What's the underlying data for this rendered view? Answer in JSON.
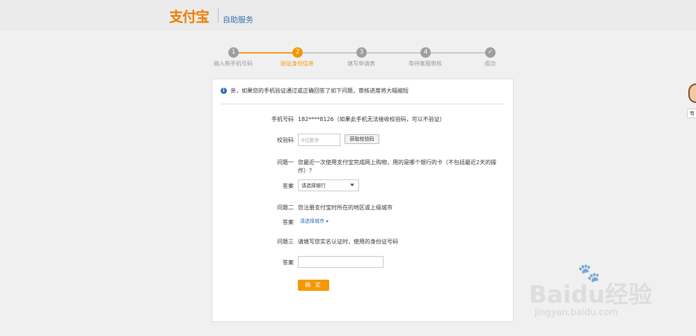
{
  "header": {
    "logo_text": "支付宝",
    "service_title": "自助服务"
  },
  "steps": [
    {
      "num": "1",
      "label": "输入新手机号码",
      "state": "done"
    },
    {
      "num": "2",
      "label": "验证身份信息",
      "state": "active"
    },
    {
      "num": "3",
      "label": "填写申请表",
      "state": "todo"
    },
    {
      "num": "4",
      "label": "等待客服审核",
      "state": "todo"
    },
    {
      "num": "✓",
      "label": "成功",
      "state": "todo"
    }
  ],
  "notice": {
    "icon": "info-icon",
    "text": "亲，如果您的手机验证通过或正确回答了如下问题，审核进度将大幅缩短"
  },
  "form": {
    "phone_label": "手机号码",
    "phone_value": "182****8126（如果此手机无法接收校验码，可以不验证）",
    "code_label": "校验码",
    "code_placeholder": "6位数字",
    "get_code_button": "获取校验码",
    "q1_label": "问题一",
    "q1_text_line1": "您最近一次使用支付宝完成网上购物，用的是哪个银行的卡（不包括最近2天的操",
    "q1_text_line2": "作）？",
    "answer_label": "答案",
    "bank_select": "请选择银行",
    "q2_label": "问题二",
    "q2_text": "您注册支付宝时所在的地区或上级城市",
    "city_select": "请选择城市",
    "q3_label": "问题三",
    "q3_text": "请填写您实名认证时，使用的身份证号码",
    "confirm_button": "确 定"
  },
  "side_helper": {
    "tag": "有"
  },
  "watermark": {
    "brand": "Baidu经验",
    "url": "jingyan.baidu.com"
  },
  "colors": {
    "accent": "#f39800",
    "link": "#2b6dbb"
  }
}
